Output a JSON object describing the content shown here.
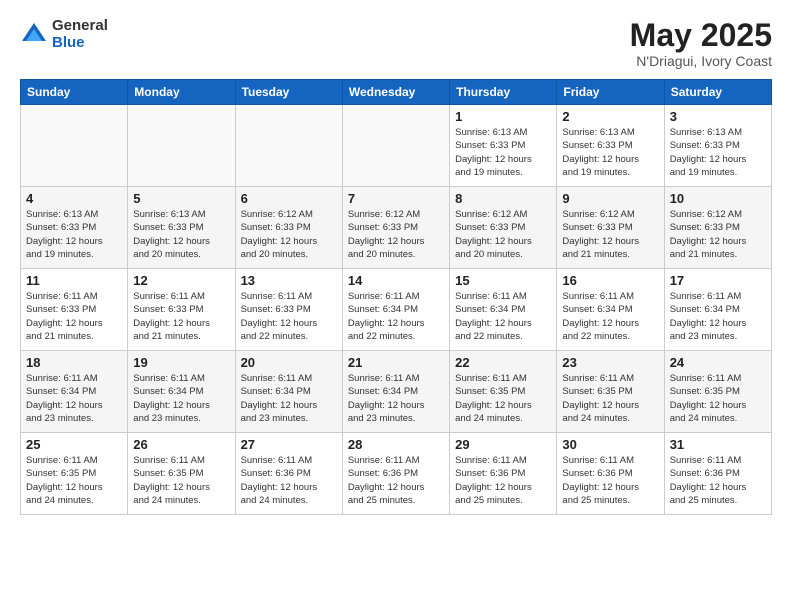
{
  "logo": {
    "general": "General",
    "blue": "Blue"
  },
  "title": {
    "month": "May 2025",
    "location": "N'Driagui, Ivory Coast"
  },
  "weekdays": [
    "Sunday",
    "Monday",
    "Tuesday",
    "Wednesday",
    "Thursday",
    "Friday",
    "Saturday"
  ],
  "weeks": [
    [
      {
        "day": "",
        "info": ""
      },
      {
        "day": "",
        "info": ""
      },
      {
        "day": "",
        "info": ""
      },
      {
        "day": "",
        "info": ""
      },
      {
        "day": "1",
        "info": "Sunrise: 6:13 AM\nSunset: 6:33 PM\nDaylight: 12 hours\nand 19 minutes."
      },
      {
        "day": "2",
        "info": "Sunrise: 6:13 AM\nSunset: 6:33 PM\nDaylight: 12 hours\nand 19 minutes."
      },
      {
        "day": "3",
        "info": "Sunrise: 6:13 AM\nSunset: 6:33 PM\nDaylight: 12 hours\nand 19 minutes."
      }
    ],
    [
      {
        "day": "4",
        "info": "Sunrise: 6:13 AM\nSunset: 6:33 PM\nDaylight: 12 hours\nand 19 minutes."
      },
      {
        "day": "5",
        "info": "Sunrise: 6:13 AM\nSunset: 6:33 PM\nDaylight: 12 hours\nand 20 minutes."
      },
      {
        "day": "6",
        "info": "Sunrise: 6:12 AM\nSunset: 6:33 PM\nDaylight: 12 hours\nand 20 minutes."
      },
      {
        "day": "7",
        "info": "Sunrise: 6:12 AM\nSunset: 6:33 PM\nDaylight: 12 hours\nand 20 minutes."
      },
      {
        "day": "8",
        "info": "Sunrise: 6:12 AM\nSunset: 6:33 PM\nDaylight: 12 hours\nand 20 minutes."
      },
      {
        "day": "9",
        "info": "Sunrise: 6:12 AM\nSunset: 6:33 PM\nDaylight: 12 hours\nand 21 minutes."
      },
      {
        "day": "10",
        "info": "Sunrise: 6:12 AM\nSunset: 6:33 PM\nDaylight: 12 hours\nand 21 minutes."
      }
    ],
    [
      {
        "day": "11",
        "info": "Sunrise: 6:11 AM\nSunset: 6:33 PM\nDaylight: 12 hours\nand 21 minutes."
      },
      {
        "day": "12",
        "info": "Sunrise: 6:11 AM\nSunset: 6:33 PM\nDaylight: 12 hours\nand 21 minutes."
      },
      {
        "day": "13",
        "info": "Sunrise: 6:11 AM\nSunset: 6:33 PM\nDaylight: 12 hours\nand 22 minutes."
      },
      {
        "day": "14",
        "info": "Sunrise: 6:11 AM\nSunset: 6:34 PM\nDaylight: 12 hours\nand 22 minutes."
      },
      {
        "day": "15",
        "info": "Sunrise: 6:11 AM\nSunset: 6:34 PM\nDaylight: 12 hours\nand 22 minutes."
      },
      {
        "day": "16",
        "info": "Sunrise: 6:11 AM\nSunset: 6:34 PM\nDaylight: 12 hours\nand 22 minutes."
      },
      {
        "day": "17",
        "info": "Sunrise: 6:11 AM\nSunset: 6:34 PM\nDaylight: 12 hours\nand 23 minutes."
      }
    ],
    [
      {
        "day": "18",
        "info": "Sunrise: 6:11 AM\nSunset: 6:34 PM\nDaylight: 12 hours\nand 23 minutes."
      },
      {
        "day": "19",
        "info": "Sunrise: 6:11 AM\nSunset: 6:34 PM\nDaylight: 12 hours\nand 23 minutes."
      },
      {
        "day": "20",
        "info": "Sunrise: 6:11 AM\nSunset: 6:34 PM\nDaylight: 12 hours\nand 23 minutes."
      },
      {
        "day": "21",
        "info": "Sunrise: 6:11 AM\nSunset: 6:34 PM\nDaylight: 12 hours\nand 23 minutes."
      },
      {
        "day": "22",
        "info": "Sunrise: 6:11 AM\nSunset: 6:35 PM\nDaylight: 12 hours\nand 24 minutes."
      },
      {
        "day": "23",
        "info": "Sunrise: 6:11 AM\nSunset: 6:35 PM\nDaylight: 12 hours\nand 24 minutes."
      },
      {
        "day": "24",
        "info": "Sunrise: 6:11 AM\nSunset: 6:35 PM\nDaylight: 12 hours\nand 24 minutes."
      }
    ],
    [
      {
        "day": "25",
        "info": "Sunrise: 6:11 AM\nSunset: 6:35 PM\nDaylight: 12 hours\nand 24 minutes."
      },
      {
        "day": "26",
        "info": "Sunrise: 6:11 AM\nSunset: 6:35 PM\nDaylight: 12 hours\nand 24 minutes."
      },
      {
        "day": "27",
        "info": "Sunrise: 6:11 AM\nSunset: 6:36 PM\nDaylight: 12 hours\nand 24 minutes."
      },
      {
        "day": "28",
        "info": "Sunrise: 6:11 AM\nSunset: 6:36 PM\nDaylight: 12 hours\nand 25 minutes."
      },
      {
        "day": "29",
        "info": "Sunrise: 6:11 AM\nSunset: 6:36 PM\nDaylight: 12 hours\nand 25 minutes."
      },
      {
        "day": "30",
        "info": "Sunrise: 6:11 AM\nSunset: 6:36 PM\nDaylight: 12 hours\nand 25 minutes."
      },
      {
        "day": "31",
        "info": "Sunrise: 6:11 AM\nSunset: 6:36 PM\nDaylight: 12 hours\nand 25 minutes."
      }
    ]
  ]
}
